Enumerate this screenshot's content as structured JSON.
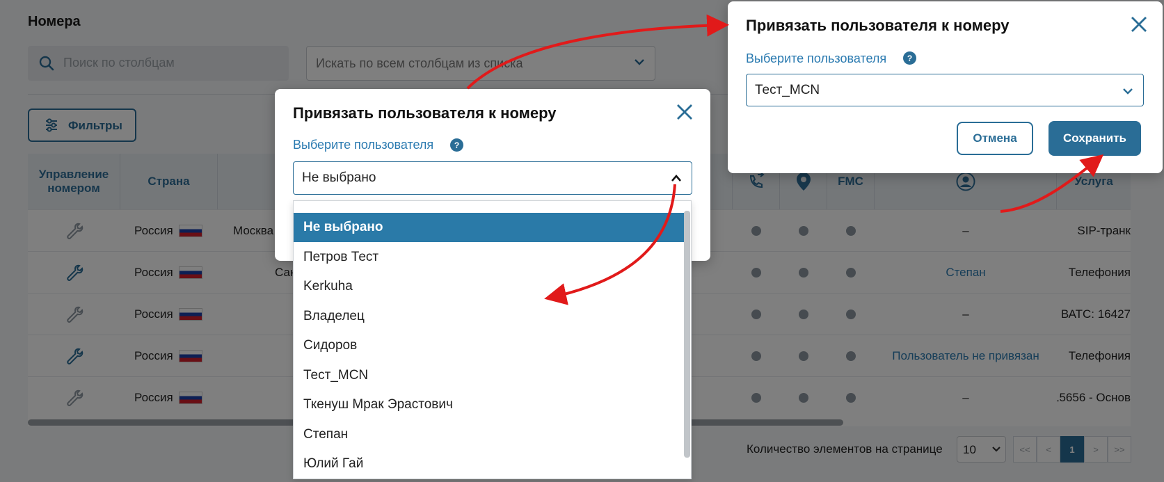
{
  "page": {
    "title": "Номера",
    "search_placeholder": "Поиск по столбцам",
    "column_select_placeholder": "Искать по всем столбцам из списка",
    "filters_label": "Фильтры"
  },
  "table": {
    "headers": {
      "manage": "Управление номером",
      "country": "Страна",
      "fmc": "FMC",
      "service": "Услуга"
    },
    "rows": [
      {
        "country": "Россия",
        "city": "Москва",
        "user": "–",
        "service": "SIP-транк",
        "wrench_active": false
      },
      {
        "country": "Россия",
        "city": "Сан",
        "user": "Степан",
        "service": "Телефония",
        "wrench_active": true
      },
      {
        "country": "Россия",
        "city": "",
        "user": "–",
        "service": "ВАТС: 16427",
        "wrench_active": false
      },
      {
        "country": "Россия",
        "city": "",
        "user": "Пользователь не привязан",
        "service": "Телефония",
        "wrench_active": true
      },
      {
        "country": "Россия",
        "city": "",
        "user": "–",
        "service": "15656 - Основ",
        "wrench_active": false
      }
    ]
  },
  "pagination": {
    "label": "Количество элементов на странице",
    "page_size": "10",
    "first": "<<",
    "prev": "<",
    "current": "1",
    "next": ">",
    "last": ">>"
  },
  "modal_back": {
    "title": "Привязать пользователя к номеру",
    "label": "Выберите пользователя",
    "help": "?",
    "selected": "Не выбрано",
    "options": [
      "Не выбрано",
      "Петров Тест",
      "Kerkuha",
      "Владелец",
      "Сидоров",
      "Тест_MCN",
      "Ткенуш Мрак Эрастович",
      "Степан",
      "Юлий Гай"
    ]
  },
  "modal_front": {
    "title": "Привязать пользователя к номеру",
    "label": "Выберите пользователя",
    "help": "?",
    "selected": "Тест_MCN",
    "cancel_label": "Отмена",
    "save_label": "Сохранить"
  },
  "colors": {
    "accent": "#2a6d96",
    "highlight": "#2a7aa8",
    "arrow": "#e11a1a"
  }
}
